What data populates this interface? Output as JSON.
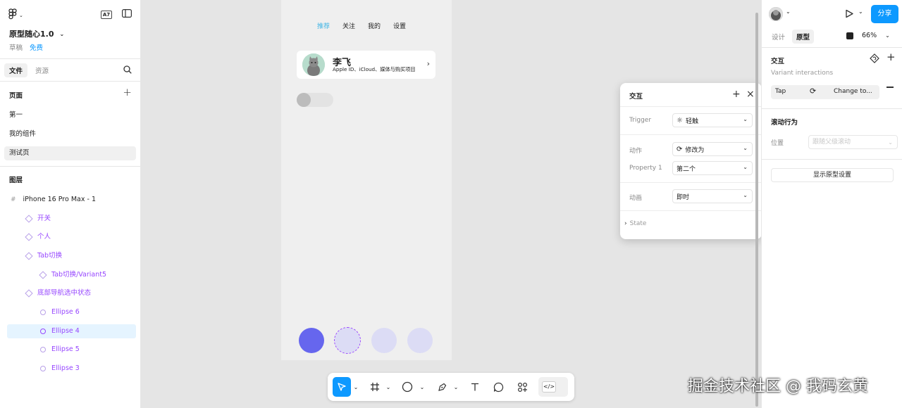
{
  "left_panel": {
    "ai_badge": "A7",
    "project_title": "原型随心1.0",
    "draft_label": "草稿",
    "plan_label": "免费",
    "tabs": [
      "文件",
      "资源"
    ],
    "pages_heading": "页面",
    "pages": [
      "第一",
      "我的组件",
      "测试页"
    ],
    "layers_heading": "图层",
    "layers": [
      {
        "label": "iPhone 16 Pro Max - 1",
        "icon": "frame-icon"
      },
      {
        "label": "开关",
        "icon": "component-icon"
      },
      {
        "label": "个人",
        "icon": "component-icon"
      },
      {
        "label": "Tab切换",
        "icon": "component-icon"
      },
      {
        "label": "Tab切换/Variant5",
        "icon": "component-icon"
      },
      {
        "label": "底部导航选中状态",
        "icon": "component-icon"
      },
      {
        "label": "Ellipse 6",
        "icon": "ellipse-icon"
      },
      {
        "label": "Ellipse 4",
        "icon": "ellipse-icon"
      },
      {
        "label": "Ellipse 5",
        "icon": "ellipse-icon"
      },
      {
        "label": "Ellipse 3",
        "icon": "ellipse-icon"
      }
    ]
  },
  "phone": {
    "tabs": [
      "推荐",
      "关注",
      "我的",
      "设置"
    ],
    "active_tab_color": "#3fb5e5",
    "profile_name": "李飞",
    "profile_desc": "Apple ID、iCloud、媒体与购买项目",
    "dot_colors": [
      "#6666ee",
      "#dcdcf5",
      "#dcdcf5",
      "#dcdcf5"
    ]
  },
  "popup": {
    "title": "交互",
    "trigger_label": "Trigger",
    "trigger_value": "轻触",
    "action_label": "动作",
    "action_value": "修改为",
    "property_label": "Property 1",
    "property_value": "第二个",
    "animation_label": "动画",
    "animation_value": "即时",
    "state_label": "State"
  },
  "right_panel": {
    "share_label": "分享",
    "tabs": [
      "设计",
      "原型"
    ],
    "zoom": "66%",
    "interaction_heading": "交互",
    "interaction_sub": "Variant interactions",
    "tap_label": "Tap",
    "change_label": "Change to...",
    "scroll_heading": "滚动行为",
    "position_label": "位置",
    "position_placeholder": "跟随父级滚动",
    "proto_settings": "显示原型设置"
  },
  "watermark": "掘金技术社区 @ 我码玄黄",
  "colors": {
    "accent": "#0d99ff",
    "component": "#9747ff"
  }
}
